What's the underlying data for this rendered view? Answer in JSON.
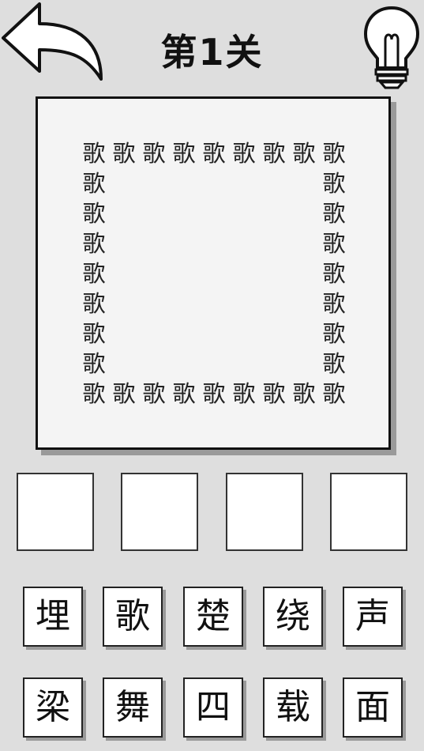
{
  "header": {
    "title": "第1关",
    "back_icon": "back-arrow-icon",
    "hint_icon": "lightbulb-icon"
  },
  "puzzle": {
    "char": "歌",
    "pattern": "hollow-square",
    "grid_size": 9
  },
  "answer_slots": [
    "",
    "",
    "",
    ""
  ],
  "tiles": [
    "埋",
    "歌",
    "楚",
    "绕",
    "声",
    "梁",
    "舞",
    "四",
    "载",
    "面"
  ]
}
